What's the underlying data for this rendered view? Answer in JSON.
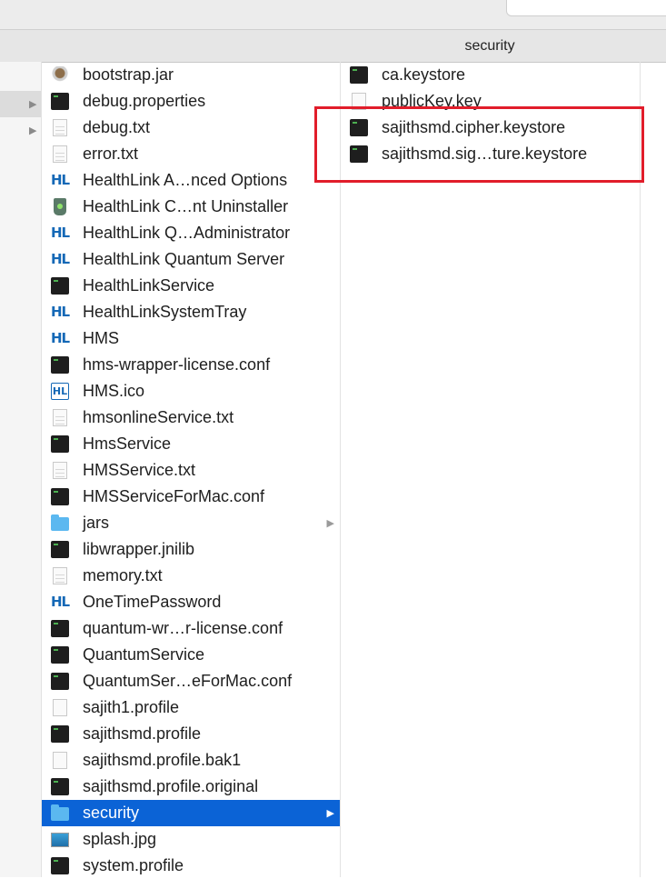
{
  "header": {
    "title": "security"
  },
  "colors": {
    "selection": "#0b63d6",
    "highlight_box": "#e11d2a",
    "hl_brand": "#1468b6"
  },
  "column1": {
    "items": [
      {
        "label": "bootstrap.jar",
        "icon": "jar-icon",
        "folder": false,
        "selected": false
      },
      {
        "label": "debug.properties",
        "icon": "exec-icon",
        "folder": false,
        "selected": false
      },
      {
        "label": "debug.txt",
        "icon": "text-file-icon",
        "folder": false,
        "selected": false
      },
      {
        "label": "error.txt",
        "icon": "text-file-icon",
        "folder": false,
        "selected": false
      },
      {
        "label": "HealthLink A…nced Options",
        "icon": "healthlink-icon",
        "folder": false,
        "selected": false
      },
      {
        "label": "HealthLink C…nt Uninstaller",
        "icon": "trash-icon",
        "folder": false,
        "selected": false
      },
      {
        "label": "HealthLink Q…Administrator",
        "icon": "healthlink-icon",
        "folder": false,
        "selected": false
      },
      {
        "label": "HealthLink Quantum Server",
        "icon": "healthlink-icon",
        "folder": false,
        "selected": false
      },
      {
        "label": "HealthLinkService",
        "icon": "exec-icon",
        "folder": false,
        "selected": false
      },
      {
        "label": "HealthLinkSystemTray",
        "icon": "healthlink-icon",
        "folder": false,
        "selected": false
      },
      {
        "label": "HMS",
        "icon": "healthlink-icon",
        "folder": false,
        "selected": false
      },
      {
        "label": "hms-wrapper-license.conf",
        "icon": "exec-icon",
        "folder": false,
        "selected": false
      },
      {
        "label": "HMS.ico",
        "icon": "healthlink-box-icon",
        "folder": false,
        "selected": false
      },
      {
        "label": "hmsonlineService.txt",
        "icon": "text-file-icon",
        "folder": false,
        "selected": false
      },
      {
        "label": "HmsService",
        "icon": "exec-icon",
        "folder": false,
        "selected": false
      },
      {
        "label": "HMSService.txt",
        "icon": "text-file-icon",
        "folder": false,
        "selected": false
      },
      {
        "label": "HMSServiceForMac.conf",
        "icon": "exec-icon",
        "folder": false,
        "selected": false
      },
      {
        "label": "jars",
        "icon": "folder-icon",
        "folder": true,
        "selected": false
      },
      {
        "label": "libwrapper.jnilib",
        "icon": "exec-icon",
        "folder": false,
        "selected": false
      },
      {
        "label": "memory.txt",
        "icon": "text-file-icon",
        "folder": false,
        "selected": false
      },
      {
        "label": "OneTimePassword",
        "icon": "healthlink-icon",
        "folder": false,
        "selected": false
      },
      {
        "label": "quantum-wr…r-license.conf",
        "icon": "exec-icon",
        "folder": false,
        "selected": false
      },
      {
        "label": "QuantumService",
        "icon": "exec-icon",
        "folder": false,
        "selected": false
      },
      {
        "label": "QuantumSer…eForMac.conf",
        "icon": "exec-icon",
        "folder": false,
        "selected": false
      },
      {
        "label": "sajith1.profile",
        "icon": "blank-document-icon",
        "folder": false,
        "selected": false
      },
      {
        "label": "sajithsmd.profile",
        "icon": "exec-icon",
        "folder": false,
        "selected": false
      },
      {
        "label": "sajithsmd.profile.bak1",
        "icon": "blank-document-icon",
        "folder": false,
        "selected": false
      },
      {
        "label": "sajithsmd.profile.original",
        "icon": "exec-icon",
        "folder": false,
        "selected": false
      },
      {
        "label": "security",
        "icon": "folder-icon",
        "folder": true,
        "selected": true
      },
      {
        "label": "splash.jpg",
        "icon": "image-icon",
        "folder": false,
        "selected": false
      },
      {
        "label": "system.profile",
        "icon": "exec-icon",
        "folder": false,
        "selected": false
      }
    ]
  },
  "column2": {
    "items": [
      {
        "label": "ca.keystore",
        "icon": "exec-icon",
        "highlighted": false
      },
      {
        "label": "publicKey.key",
        "icon": "blank-document-icon",
        "highlighted": false
      },
      {
        "label": "sajithsmd.cipher.keystore",
        "icon": "exec-icon",
        "highlighted": true
      },
      {
        "label": "sajithsmd.sig…ture.keystore",
        "icon": "exec-icon",
        "highlighted": true
      }
    ]
  }
}
